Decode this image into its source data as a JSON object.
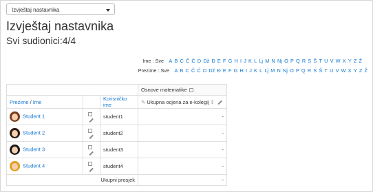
{
  "select": {
    "value": "Izvještaj nastavnika"
  },
  "page": {
    "title": "Izvještaj nastavnika",
    "participants": "Svi sudionici:4/4"
  },
  "filters": {
    "first_name_label": "Ime : Sve",
    "last_name_label": "Prezime : Sve",
    "letters": [
      "A",
      "B",
      "C",
      "Č",
      "Ć",
      "D",
      "Dž",
      "Đ",
      "E",
      "F",
      "G",
      "H",
      "I",
      "J",
      "K",
      "L",
      "Lj",
      "M",
      "N",
      "Nj",
      "O",
      "P",
      "Q",
      "R",
      "S",
      "Š",
      "T",
      "U",
      "V",
      "W",
      "X",
      "Y",
      "Z",
      "Ž"
    ]
  },
  "table": {
    "category_header": "Osnove matematike",
    "col_lastname": "Prezime",
    "col_firstname": "Ime",
    "col_username": "Korisničko ime",
    "col_total": "Ukupna ocjena za e-kolegij",
    "rows": [
      {
        "name": "Student 1",
        "username": "student1",
        "grade": "-",
        "avatar_color": "#7a3b1c"
      },
      {
        "name": "Student 2",
        "username": "student2",
        "grade": "-",
        "avatar_color": "#2b1a10"
      },
      {
        "name": "Student 3",
        "username": "student3",
        "grade": "-",
        "avatar_color": "#1a1a1a"
      },
      {
        "name": "Student 4",
        "username": "student4",
        "grade": "-",
        "avatar_color": "#e0a020"
      }
    ],
    "average_label": "Ukupni prosjek",
    "average_value": "-"
  }
}
